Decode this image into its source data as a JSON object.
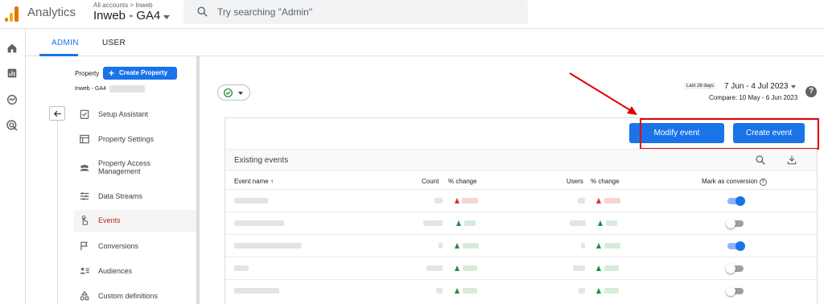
{
  "topbar": {
    "app_name": "Analytics",
    "breadcrumb": "All accounts > Inweb",
    "property_name": "Inweb - GA4",
    "search_placeholder": "Try searching \"Admin\""
  },
  "tabs": [
    {
      "label": "ADMIN",
      "active": true
    },
    {
      "label": "USER",
      "active": false
    }
  ],
  "property_panel": {
    "label": "Property",
    "create_button": "Create Property",
    "property_short": "Inweb - GA4"
  },
  "nav_items": [
    {
      "label": "Setup Assistant",
      "icon": "checklist-icon",
      "selected": false
    },
    {
      "label": "Property Settings",
      "icon": "settings-window-icon",
      "selected": false
    },
    {
      "label": "Property Access Management",
      "icon": "people-icon",
      "selected": false
    },
    {
      "label": "Data Streams",
      "icon": "streams-icon",
      "selected": false
    },
    {
      "label": "Events",
      "icon": "touch-icon",
      "selected": true
    },
    {
      "label": "Conversions",
      "icon": "flag-icon",
      "selected": false
    },
    {
      "label": "Audiences",
      "icon": "audience-icon",
      "selected": false
    },
    {
      "label": "Custom definitions",
      "icon": "shapes-icon",
      "selected": false
    }
  ],
  "date_range": {
    "tag": "Last 28 days",
    "range": "7 Jun - 4 Jul 2023",
    "compare": "Compare: 10 May - 6 Jun 2023"
  },
  "buttons": {
    "modify_event": "Modify event",
    "create_event": "Create event"
  },
  "table": {
    "title": "Existing events",
    "headers": {
      "event_name": "Event name",
      "count": "Count",
      "pct_change": "% change",
      "users": "Users",
      "pct_change_users": "% change",
      "mark_conversion": "Mark as conversion"
    },
    "rows": [
      {
        "trend_count": "down",
        "trend_users": "down",
        "conversion": true
      },
      {
        "trend_count": "up",
        "trend_users": "up",
        "conversion": false
      },
      {
        "trend_count": "up",
        "trend_users": "up",
        "conversion": true
      },
      {
        "trend_count": "up",
        "trend_users": "up",
        "conversion": false
      },
      {
        "trend_count": "up",
        "trend_users": "up",
        "conversion": false
      }
    ]
  },
  "colors": {
    "primary": "#1a73e8",
    "annotation_red": "#e00000",
    "trend_up": "#1e8e3e",
    "trend_down": "#d93025"
  }
}
